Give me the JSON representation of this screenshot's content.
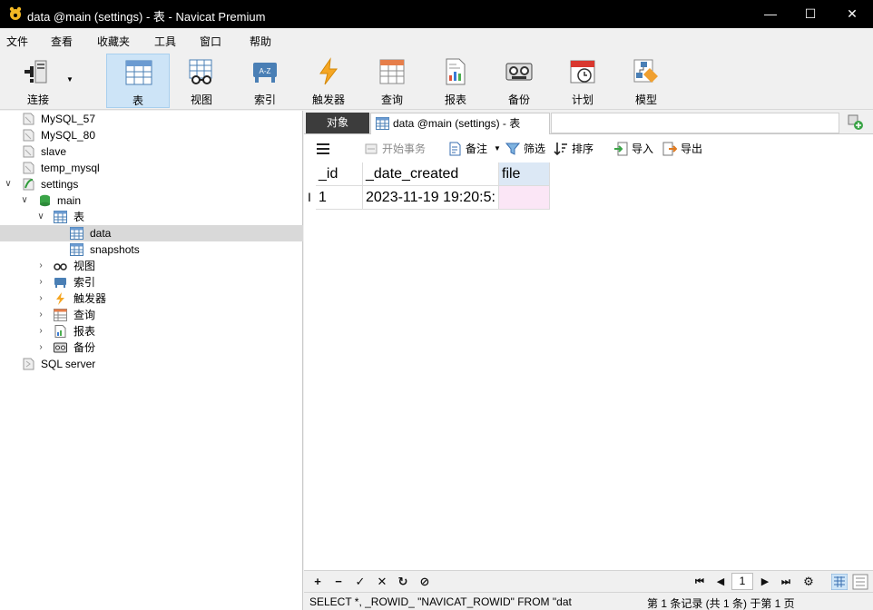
{
  "window": {
    "title": "data @main (settings) - 表 - Navicat Premium",
    "controls": [
      "—",
      "☐",
      "✕"
    ]
  },
  "menu": [
    "文件",
    "查看",
    "收藏夹",
    "工具",
    "窗口",
    "帮助"
  ],
  "toolbar": {
    "connect": "连接",
    "table": "表",
    "view": "视图",
    "index": "索引",
    "trigger": "触发器",
    "query": "查询",
    "report": "报表",
    "backup": "备份",
    "schedule": "计划",
    "model": "模型"
  },
  "tree": {
    "conn1": "MySQL_57",
    "conn2": "MySQL_80",
    "conn3": "slave",
    "conn4": "temp_mysql",
    "conn5": "settings",
    "db": "main",
    "tables": "表",
    "table1": "data",
    "table2": "snapshots",
    "views": "视图",
    "indexes": "索引",
    "triggers": "触发器",
    "queries": "查询",
    "reports": "报表",
    "backups": "备份",
    "conn6": "SQL server"
  },
  "tabs": {
    "objects": "对象",
    "data_tab": "data @main (settings) - 表"
  },
  "subtoolbar": {
    "menu_icon": "menu-icon",
    "begin_tx": "开始事务",
    "memo": "备注",
    "filter": "筛选",
    "sort": "排序",
    "import": "导入",
    "export": "导出"
  },
  "grid": {
    "columns": [
      "_id",
      "_date_created",
      "file"
    ],
    "row": {
      "id": "1",
      "date_created": "2023-11-19 19:20:5:",
      "file": ""
    }
  },
  "navbar": {
    "add": "+",
    "delete": "−",
    "apply": "✓",
    "cancel": "✕",
    "refresh": "↻",
    "stop": "⊘",
    "first": "⏮",
    "prev": "◀",
    "page": "1",
    "next": "▶",
    "last": "⏭",
    "settings": "⚙"
  },
  "status": {
    "sql": "SELECT *, _ROWID_ \"NAVICAT_ROWID\" FROM \"dat",
    "records": "第 1 条记录 (共 1 条) 于第 1 页"
  },
  "colors": {
    "titlebar": "#000000",
    "accent": "#cde4f7",
    "selected_row": "#d9d9d9",
    "editing_cell": "#fbe6f6"
  }
}
